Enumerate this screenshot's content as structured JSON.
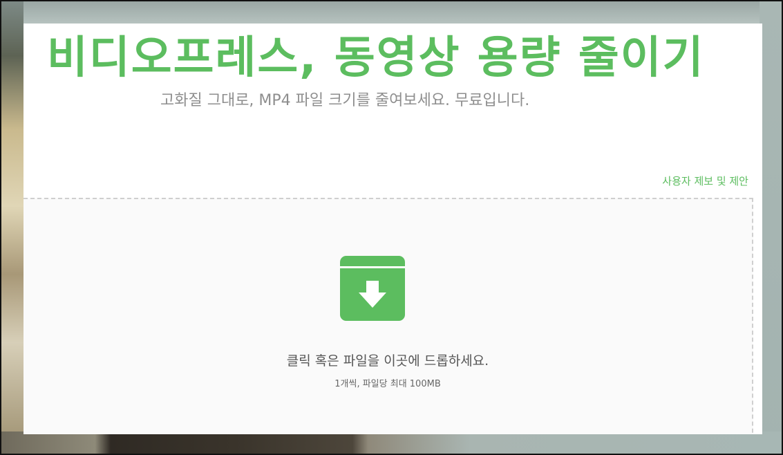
{
  "header": {
    "title": "비디오프레스, 동영상 용량 줄이기",
    "subtitle": "고화질 그대로, MP4 파일 크기를 줄여보세요. 무료입니다."
  },
  "links": {
    "feedback": "사용자 제보 및 제안"
  },
  "dropzone": {
    "icon": "archive-download-icon",
    "instruction": "클릭 혹은 파일을 이곳에 드롭하세요.",
    "limits": "1개씩, 파일당 최대 100MB"
  },
  "colors": {
    "accent": "#5cbd5f",
    "subtitle": "#8e8e8e",
    "dropzone_bg": "#fafafa",
    "dropzone_border": "#cfcfcf"
  }
}
